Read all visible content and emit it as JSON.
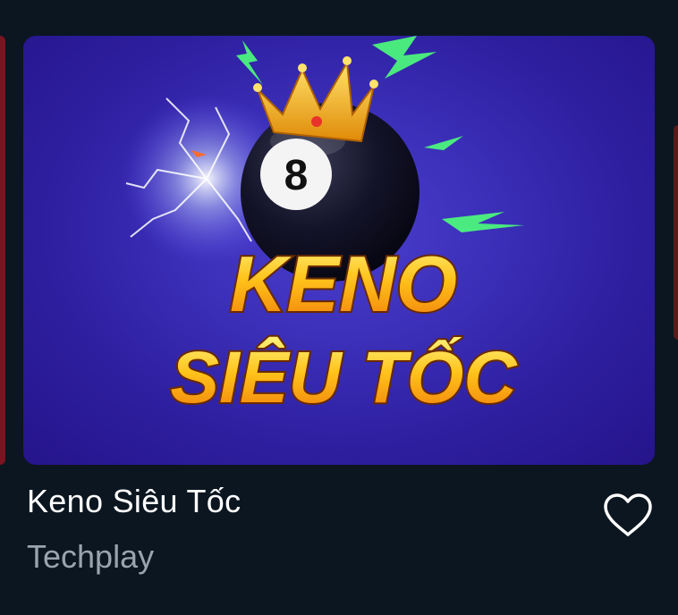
{
  "game": {
    "thumbnail_text_line1": "KENO",
    "thumbnail_text_line2": "SIÊU TỐC",
    "ball_number": "8",
    "title": "Keno Siêu Tốc",
    "provider": "Techplay",
    "favorite_icon": "heart-outline-icon"
  },
  "colors": {
    "page_bg": "#0b1620",
    "card_bg": "#3b2fb8",
    "title_gold": "#ffc21a",
    "provider_text": "#9aa4ae"
  }
}
